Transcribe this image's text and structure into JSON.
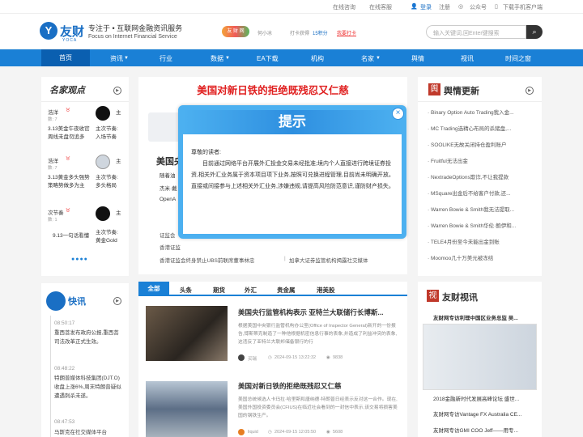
{
  "topbar": {
    "consult": "在线咨询",
    "service": "在线客服",
    "login": "登录",
    "register": "注册",
    "wechat": "公众号",
    "download": "下载手机客户端"
  },
  "header": {
    "logo_cn": "友财",
    "logo_en": "YOCA",
    "slogan_cn": "专注于 • 互联网金融资讯服务",
    "slogan_en": "Focus on Internet Financial Service",
    "chips": "友 财 网",
    "user": "何小冰",
    "checkin_label": "打卡获得",
    "points": "15积分",
    "checkin_btn": "我要打卡",
    "search_placeholder": "输入关键词,回Enter键搜索"
  },
  "nav": [
    "首页",
    "资讯",
    "行业",
    "数据",
    "EA下载",
    "机构",
    "名家",
    "舆情",
    "视讯",
    "时间之窗"
  ],
  "famous": {
    "title": "名家观点",
    "items": [
      {
        "name": "浩洋",
        "sub": "数: 7",
        "text": "3.13美金午夜收官",
        "text2": "周线未盘勿追多",
        "name2": "主",
        "t2a": "主次节奏:",
        "t2b": "入场节奏"
      },
      {
        "name": "浩洋",
        "sub": "数: 7",
        "text": "3.13黄金多头强势",
        "text2": "策略势做多为主",
        "name2": "主",
        "t2a": "主次节奏:",
        "t2b": "多头格局"
      },
      {
        "name": "次节奏",
        "sub": "数: 1",
        "text": "9.13一句话看懂",
        "text2": "",
        "name2": "主",
        "t2a": "主次节奏:",
        "t2b": "黄金Gold"
      }
    ]
  },
  "live": {
    "title": "快讯",
    "items": [
      {
        "time": "08:50:17",
        "text": "重西菩发布政府公报,重西菩司法改革正式生效。"
      },
      {
        "time": "08:48:22",
        "text": "特朗普媒体科技集团(DJT.O)收盘上涨6%,周末特朗普疑似遭遇刺杀未遂。"
      },
      {
        "time": "08:47:53",
        "text": "马斯克在社交媒体平台"
      }
    ]
  },
  "center": {
    "headline": "美国对新日铁的拒绝既残忍又仁慈",
    "lead_title": "美国央",
    "lead_lines": [
      "随着油",
      "杰米·戴",
      "OpenA"
    ],
    "links": [
      "证监会",
      "香港证监",
      "香港证监会终身禁止UBS前联席董事林忠",
      "加拿大证券监管机构揭露社交媒体"
    ]
  },
  "modal": {
    "title": "提示",
    "greeting": "尊敬的读者:",
    "body": "目前通过网络平台开展外汇投金交易未经批准;境内个人直接进行跨境证券投资,相关外汇业务属于资本项目项下业务,按照可兑换进程管理,目前尚未明确开放。直接或间接参与上述相关外汇业务,涉嫌违规,请提高风险防范意识,谨防财产损失。"
  },
  "news": {
    "tabs": [
      "全部",
      "头条",
      "期货",
      "外汇",
      "贵金属",
      "港美股"
    ],
    "items": [
      {
        "title": "美国央行监管机构表示 亚特兰大联储行长博斯...",
        "desc": "根据美国中央银行监管机构办公室(Office of Inspector General)新开的一份报告,博斯蒂克制造了一种他根据机密信息行事的表象,并造成了利益冲突的表象,这违反了亚特兰大联邦储备银行的行",
        "author": "买瑞",
        "date": "2024-09-15 13:22:32",
        "views": "9838"
      },
      {
        "title": "美国对新日铁的拒绝既残忍又仁慈",
        "desc": "美国总统候选人卡玛拉·哈里斯和唐纳德·特朗普日经表示反对这一合作。现在,美国外国投资委员会(CFIUS)在临近社会看到的一封信中表示,该交易将损害美国的钢铁生产。",
        "author": "liquid",
        "date": "2024-09-15 12:05:50",
        "views": "5608"
      }
    ]
  },
  "yq": {
    "title": "舆情更新",
    "items": [
      "Binary Option Auto Trading我入金...",
      "MC Trading选精心布局的杀猪盘,...",
      "SOOLIKE无故关闭持仓盈利账户",
      "Fruitful无法出金",
      "NextradeOptions欺诈,不让我提款",
      "MSquare出金后不给客户付款,还...",
      "Warren Bowie & Smith我无法提取...",
      "Warren Bowie & Smith华伦·鲍伊和...",
      "TELE4月份至今未能出金到账",
      "Moomoo几十万美元被冻结"
    ]
  },
  "vid": {
    "title": "友财视讯",
    "caption": "友财网专访利理中国区业务总监 吴...",
    "items": [
      "2018金融新时代发展高峰论坛 盛世...",
      "友财网专访Vantage FX Australia CE...",
      "友财网专访GMI COO Jeff——用专..."
    ]
  }
}
